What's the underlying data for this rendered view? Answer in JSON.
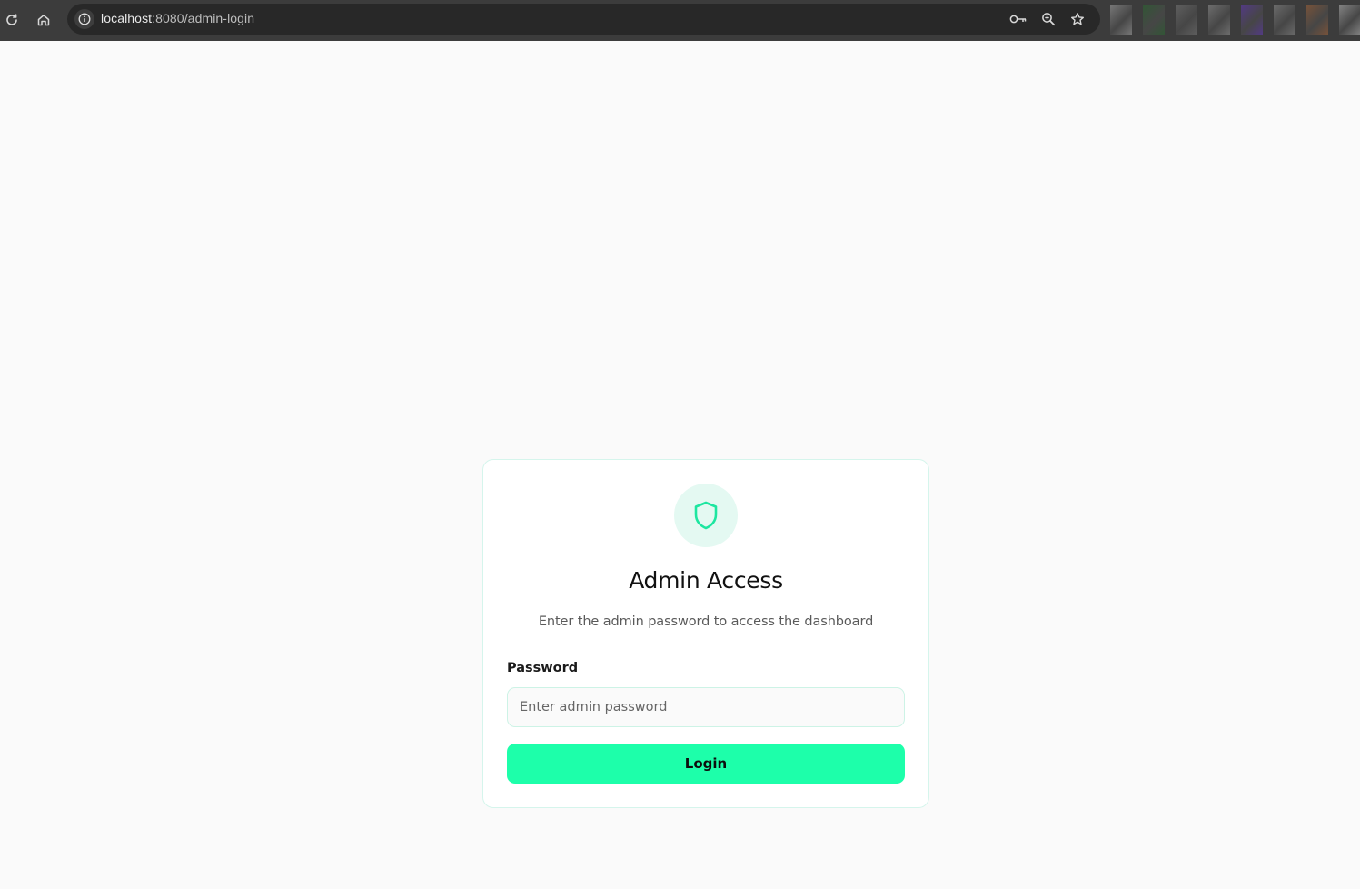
{
  "browser": {
    "url_host": "localhost",
    "url_rest": ":8080/admin-login",
    "reload_icon": "reload-icon",
    "home_icon": "home-icon",
    "site_info_icon": "info-icon",
    "password_manager_icon": "key-icon",
    "zoom_icon": "zoom-icon",
    "bookmark_icon": "star-icon",
    "extension_colors": [
      "#8a8a8a",
      "#2f5e34",
      "#6a6a6a",
      "#7d7d7d",
      "#5a3a9a",
      "#7a7a7a",
      "#8a5a3a",
      "#9a9a9a"
    ]
  },
  "login_card": {
    "icon": "shield-icon",
    "title": "Admin Access",
    "subtitle": "Enter the admin password to access the dashboard",
    "password_label": "Password",
    "password_placeholder": "Enter admin password",
    "password_value": "",
    "login_button": "Login"
  },
  "theme": {
    "accent": "#1dffaa",
    "accent_soft": "#e4f9f2",
    "accent_border": "#d5f5ec"
  }
}
